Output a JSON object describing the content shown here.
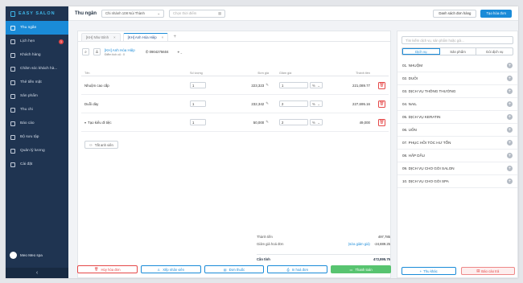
{
  "app": {
    "logo_text": "EASY SALON"
  },
  "sidebar": {
    "items": [
      {
        "label": "Thu ngân",
        "icon": "monitor-icon",
        "active": true
      },
      {
        "label": "Lịch hẹn",
        "icon": "calendar-icon",
        "badge": "1"
      },
      {
        "label": "Khách hàng",
        "icon": "users-icon"
      },
      {
        "label": "Chăm sóc khách hà...",
        "icon": "care-icon"
      },
      {
        "label": "Thẻ tiền mặt",
        "icon": "card-icon"
      },
      {
        "label": "Sản phẩm",
        "icon": "box-icon"
      },
      {
        "label": "Thu chi",
        "icon": "wallet-icon"
      },
      {
        "label": "Báo cáo",
        "icon": "chart-icon"
      },
      {
        "label": "Bộ sưu tập",
        "icon": "gallery-icon"
      },
      {
        "label": "Quản lý lương",
        "icon": "salary-icon"
      },
      {
        "label": "Cài đặt",
        "icon": "gear-icon"
      }
    ],
    "user_name": "Meo Meo spa",
    "collapse_glyph": "‹"
  },
  "topbar": {
    "title": "Thu ngân",
    "branch": "Chi nhánh 108 Núi Thành",
    "time_placeholder": "Chọn thời điểm",
    "list_button": "Danh sách đơn hàng",
    "create_button": "Tạo hóa đơn"
  },
  "tabs": [
    {
      "label": "[KH] Như Bình",
      "active": false
    },
    {
      "label": "[KH] Anh Hóa Hiệp",
      "active": true
    }
  ],
  "customer": {
    "name": "[KH] Anh Hóa Hiệp",
    "points": "Điểm tích củ : 0",
    "phone": "0904275604"
  },
  "table": {
    "headers": [
      "Tên",
      "Số lượng",
      "Đơn giá",
      "Giảm giá",
      "Thành tiền"
    ],
    "rows": [
      {
        "name": "Nhuộm cao cấp",
        "qty": "1",
        "price": "223,323",
        "discount": "1",
        "unit": "%",
        "total": "221,089.77"
      },
      {
        "name": "Duỗi dày",
        "qty": "1",
        "price": "232,342",
        "discount": "2",
        "unit": "%",
        "total": "227,695.16"
      },
      {
        "name": "Tạo kiểu đi tiệc",
        "qty": "1",
        "price": "50,000",
        "discount": "2",
        "unit": "%",
        "total": "49,000"
      }
    ]
  },
  "add_employee": "Tất anh viên",
  "summary": {
    "subtotal_label": "Thành tiền",
    "subtotal": "497,785",
    "discount_label": "Giảm giá hoá đơn",
    "discount_link": "(sửa giảm giá)",
    "discount": "-24,889.25",
    "total_label": "Cần tính",
    "total": "472,895.75"
  },
  "footer": {
    "cancel": "Hủy hóa đơn",
    "employee": "Xếp nhân viên",
    "prescription": "Đơn thuốc",
    "print": "In hoá đơn",
    "pay": "Thanh toán"
  },
  "right_panel": {
    "search_placeholder": "Tìm kiếm dịch vụ, sản phẩm hoặc gói...",
    "tabs": [
      "Dịch vụ",
      "Sản phẩm",
      "Gói dịch vụ"
    ],
    "categories": [
      "01. NHUỘM",
      "02. DUỖI",
      "03. DỊCH VỤ THÔNG THƯỜNG",
      "04. NAIL",
      "05. DỊCH VỤ KERATIN",
      "06. UỐN",
      "07. PHỤC HỒI TÓC HƯ TỔN",
      "08. HẤP DẦU",
      "09. DỊCH VỤ CHO GÓI SALON",
      "10. DỊCH VỤ CHO GÓI SPA"
    ],
    "receipt_button": "Thu khác",
    "report_button": "Báo cáo trả"
  },
  "colors": {
    "accent": "#1a8bd8",
    "sidebar": "#1f3451",
    "danger": "#e54848",
    "success": "#58c470"
  }
}
